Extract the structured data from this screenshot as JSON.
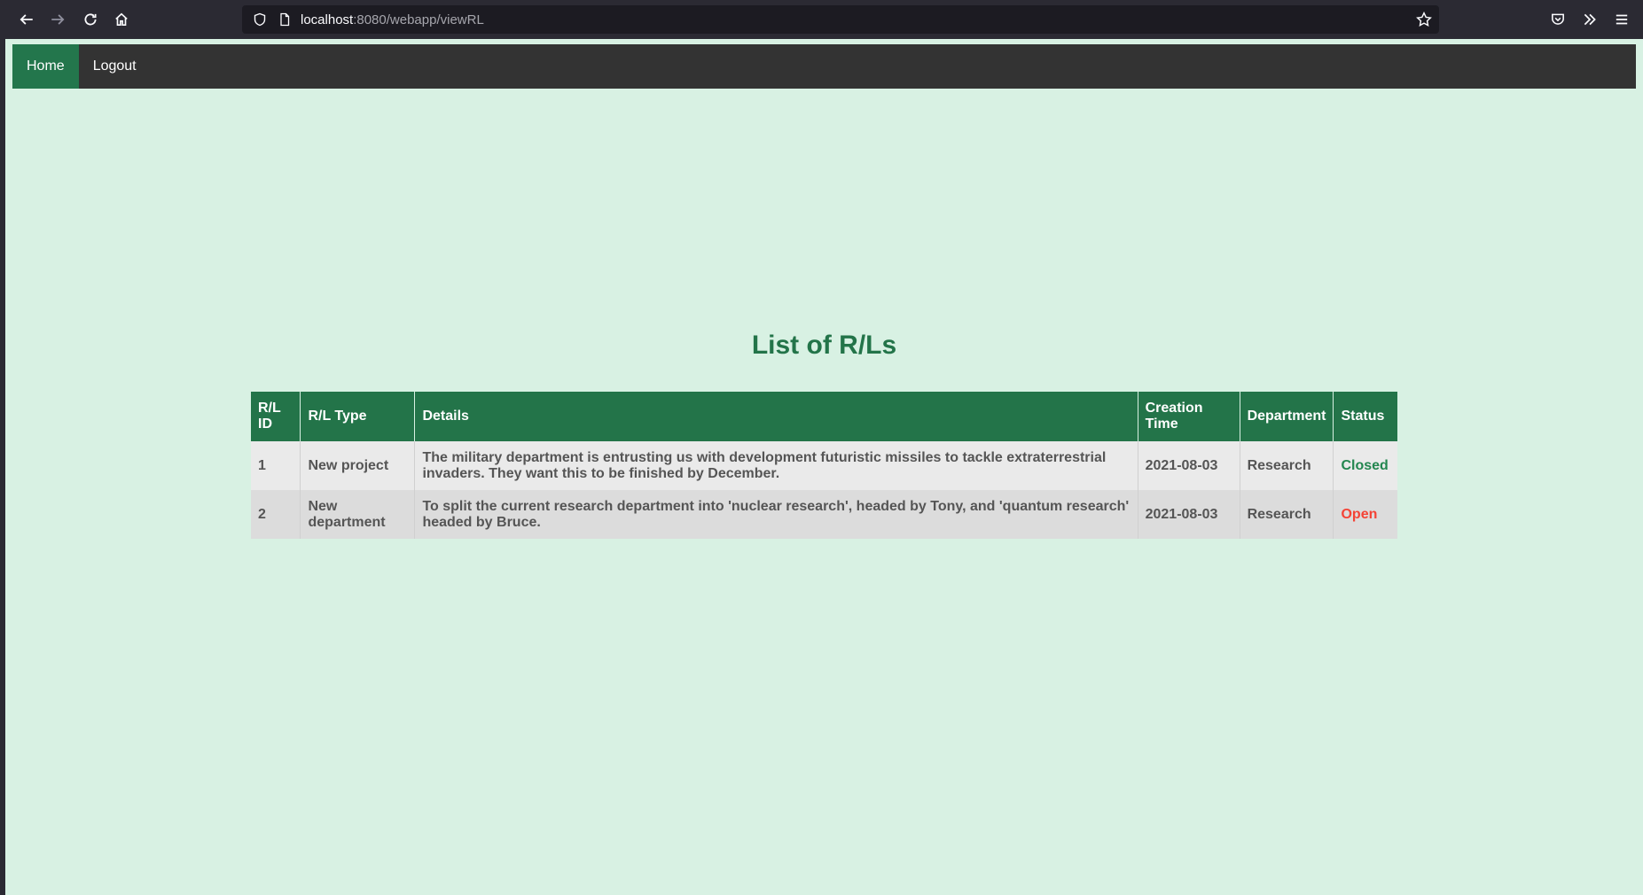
{
  "browser": {
    "url_host": "localhost",
    "url_rest": ":8080/webapp/viewRL"
  },
  "nav": {
    "items": [
      {
        "label": "Home",
        "active": true
      },
      {
        "label": "Logout",
        "active": false
      }
    ]
  },
  "page": {
    "title": "List of R/Ls"
  },
  "table": {
    "headers": [
      "R/L ID",
      "R/L Type",
      "Details",
      "Creation Time",
      "Department",
      "Status"
    ],
    "rows": [
      {
        "id": "1",
        "type": "New project",
        "details": "The military department is entrusting us with development futuristic missiles to tackle extraterrestrial invaders. They want this to be finished by December.",
        "creation_time": "2021-08-03",
        "department": "Research",
        "status": "Closed"
      },
      {
        "id": "2",
        "type": "New department",
        "details": "To split the current research department into 'nuclear research', headed by Tony, and 'quantum research' headed by Bruce.",
        "creation_time": "2021-08-03",
        "department": "Research",
        "status": "Open"
      }
    ]
  },
  "colors": {
    "accent_green": "#237449",
    "status_closed": "#23864f",
    "status_open": "#f44336",
    "page_bg": "#d8f1e3"
  }
}
